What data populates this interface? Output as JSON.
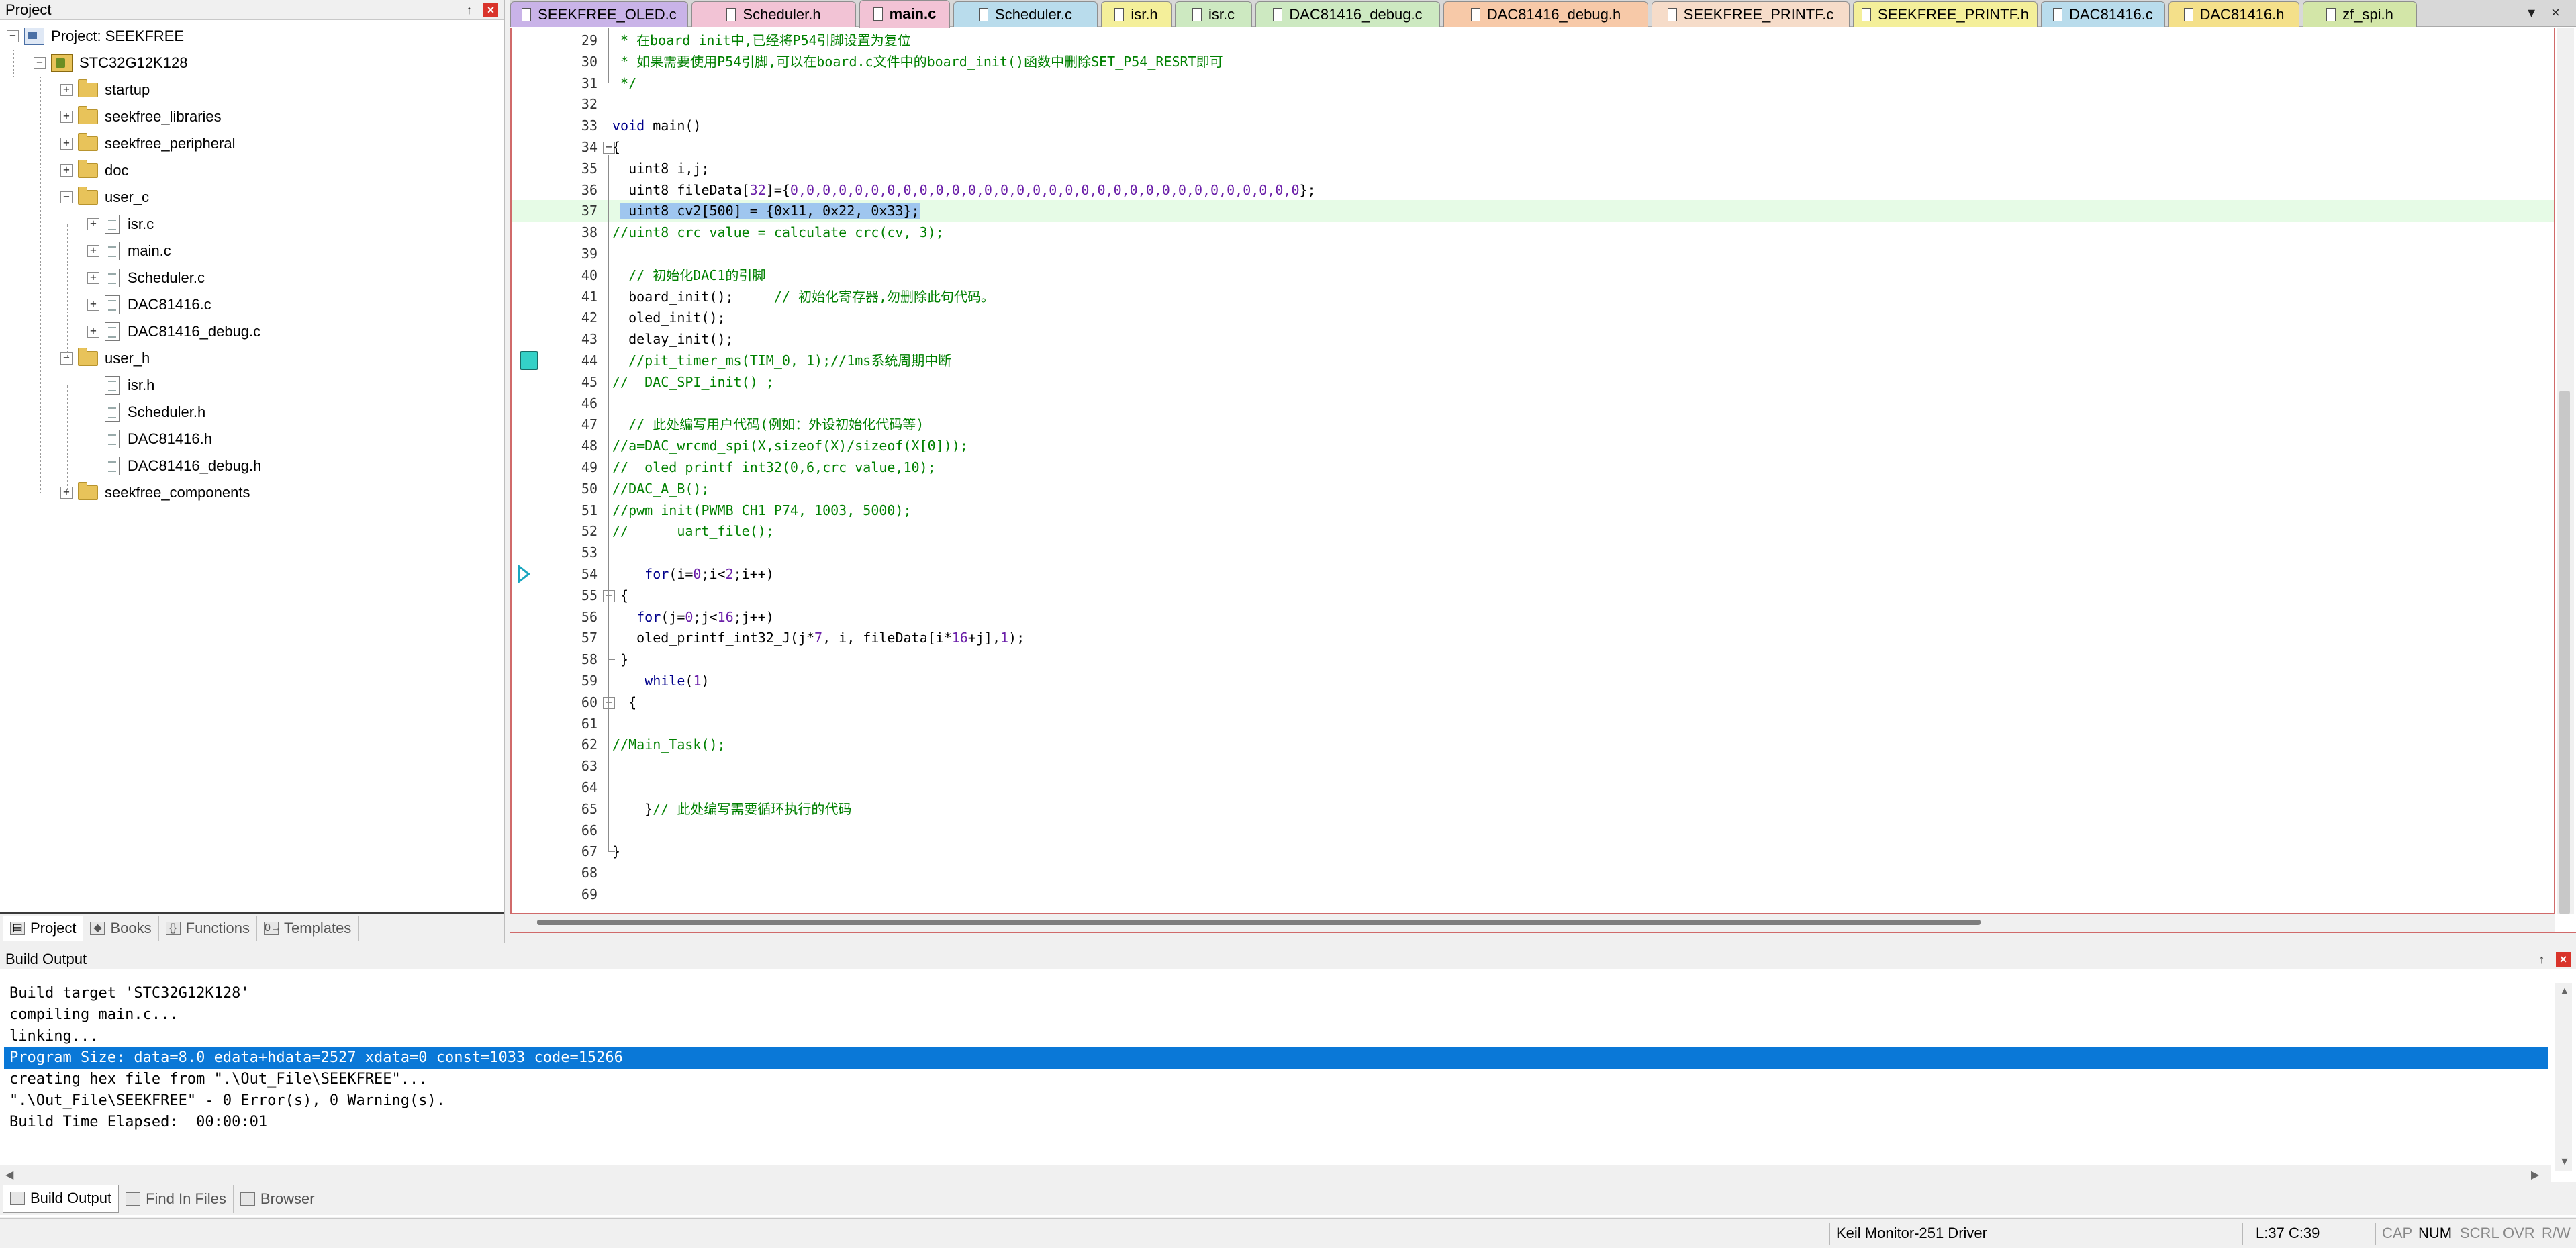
{
  "project_pane": {
    "title": "Project",
    "pin": "↑",
    "close": "×",
    "tree": [
      {
        "label": "Project: SEEKFREE",
        "kind": "project",
        "depth": 0,
        "expander": "−"
      },
      {
        "label": "STC32G12K128",
        "kind": "target",
        "depth": 1,
        "expander": "−"
      },
      {
        "label": "startup",
        "kind": "folder",
        "depth": 2,
        "expander": "+"
      },
      {
        "label": "seekfree_libraries",
        "kind": "folder",
        "depth": 2,
        "expander": "+"
      },
      {
        "label": "seekfree_peripheral",
        "kind": "folder",
        "depth": 2,
        "expander": "+"
      },
      {
        "label": "doc",
        "kind": "folder",
        "depth": 2,
        "expander": "+"
      },
      {
        "label": "user_c",
        "kind": "folder",
        "depth": 2,
        "expander": "−"
      },
      {
        "label": "isr.c",
        "kind": "file",
        "depth": 3,
        "expander": "+"
      },
      {
        "label": "main.c",
        "kind": "file",
        "depth": 3,
        "expander": "+"
      },
      {
        "label": "Scheduler.c",
        "kind": "file",
        "depth": 3,
        "expander": "+"
      },
      {
        "label": "DAC81416.c",
        "kind": "file",
        "depth": 3,
        "expander": "+"
      },
      {
        "label": "DAC81416_debug.c",
        "kind": "file",
        "depth": 3,
        "expander": "+"
      },
      {
        "label": "user_h",
        "kind": "folder",
        "depth": 2,
        "expander": "−"
      },
      {
        "label": "isr.h",
        "kind": "file",
        "depth": 3,
        "expander": ""
      },
      {
        "label": "Scheduler.h",
        "kind": "file",
        "depth": 3,
        "expander": ""
      },
      {
        "label": "DAC81416.h",
        "kind": "file",
        "depth": 3,
        "expander": ""
      },
      {
        "label": "DAC81416_debug.h",
        "kind": "file",
        "depth": 3,
        "expander": ""
      },
      {
        "label": "seekfree_components",
        "kind": "folder",
        "depth": 2,
        "expander": "+"
      }
    ],
    "tabs": [
      {
        "label": "Project",
        "icon": "▤"
      },
      {
        "label": "Books",
        "icon": "◆"
      },
      {
        "label": "Functions",
        "icon": "{}"
      },
      {
        "label": "Templates",
        "icon": "0→"
      }
    ]
  },
  "file_tabs": [
    {
      "label": "SEEKFREE_OLED.c",
      "color": "#c9b3e8"
    },
    {
      "label": "Scheduler.h",
      "color": "#f2c3d5"
    },
    {
      "label": "main.c",
      "color": "#f2c3d5",
      "active": true
    },
    {
      "label": "Scheduler.c",
      "color": "#b9dcec"
    },
    {
      "label": "isr.h",
      "color": "#f4ef9a"
    },
    {
      "label": "isr.c",
      "color": "#cde9c1"
    },
    {
      "label": "DAC81416_debug.c",
      "color": "#cde9c1"
    },
    {
      "label": "DAC81416_debug.h",
      "color": "#f7c9a8"
    },
    {
      "label": "SEEKFREE_PRINTF.c",
      "color": "#f6dcc9"
    },
    {
      "label": "SEEKFREE_PRINTF.h",
      "color": "#f4ef9a"
    },
    {
      "label": "DAC81416.c",
      "color": "#b9dcec"
    },
    {
      "label": "DAC81416.h",
      "color": "#f4e08a"
    },
    {
      "label": "zf_spi.h",
      "color": "#d3e6a8"
    }
  ],
  "tab_controls": {
    "menu": "▾",
    "close": "×"
  },
  "code_lines": [
    {
      "n": "29",
      "parts": [
        {
          "t": " * 在board_init中,已经将P54引脚设置为复位",
          "c": "comment"
        }
      ]
    },
    {
      "n": "30",
      "parts": [
        {
          "t": " * 如果需要使用P54引脚,可以在board.c文件中的board_init()函数中删除SET_P54_RESRT即可",
          "c": "comment"
        }
      ]
    },
    {
      "n": "31",
      "parts": [
        {
          "t": " */",
          "c": "comment"
        }
      ]
    },
    {
      "n": "32",
      "parts": []
    },
    {
      "n": "33",
      "parts": [
        {
          "t": "void",
          "c": "kw"
        },
        {
          "t": " main()",
          "c": ""
        }
      ]
    },
    {
      "n": "34",
      "parts": [
        {
          "t": "{",
          "c": ""
        }
      ],
      "fold": "−"
    },
    {
      "n": "35",
      "parts": [
        {
          "t": "  uint8 i,j;",
          "c": ""
        }
      ]
    },
    {
      "n": "36",
      "parts": [
        {
          "t": "  uint8 fileData[",
          "c": ""
        },
        {
          "t": "32",
          "c": "num"
        },
        {
          "t": "]={",
          "c": ""
        },
        {
          "t": "0,0,0,0,0,0,0,0,0,0,0,0,0,0,0,0,0,0,0,0,0,0,0,0,0,0,0,0,0,0,0,0",
          "c": "num"
        },
        {
          "t": "};",
          "c": ""
        }
      ]
    },
    {
      "n": "37",
      "parts": [
        {
          "t": " ",
          "c": ""
        },
        {
          "t": " uint8 cv2[500] = {0x11, 0x22, 0x33};",
          "c": "sel"
        }
      ],
      "current": true
    },
    {
      "n": "38",
      "parts": [
        {
          "t": "//uint8 crc_value = calculate_crc(cv, 3);",
          "c": "comment"
        }
      ]
    },
    {
      "n": "39",
      "parts": []
    },
    {
      "n": "40",
      "parts": [
        {
          "t": "  // 初始化DAC1的引脚",
          "c": "comment"
        }
      ]
    },
    {
      "n": "41",
      "parts": [
        {
          "t": "  board_init();     ",
          "c": ""
        },
        {
          "t": "// 初始化寄存器,勿删除此句代码。",
          "c": "comment"
        }
      ]
    },
    {
      "n": "42",
      "parts": [
        {
          "t": "  oled_init();",
          "c": ""
        }
      ]
    },
    {
      "n": "43",
      "parts": [
        {
          "t": "  delay_init();",
          "c": ""
        }
      ]
    },
    {
      "n": "44",
      "parts": [
        {
          "t": "  //pit_timer_ms(TIM_0, 1);//1ms系统周期中断",
          "c": "comment"
        }
      ],
      "marker": "bookmark"
    },
    {
      "n": "45",
      "parts": [
        {
          "t": "//  DAC_SPI_init() ;",
          "c": "comment"
        }
      ]
    },
    {
      "n": "46",
      "parts": []
    },
    {
      "n": "47",
      "parts": [
        {
          "t": "  // 此处编写用户代码(例如：外设初始化代码等)",
          "c": "comment"
        }
      ]
    },
    {
      "n": "48",
      "parts": [
        {
          "t": "//a=DAC_wrcmd_spi(X,sizeof(X)/sizeof(X[0]));",
          "c": "comment"
        }
      ]
    },
    {
      "n": "49",
      "parts": [
        {
          "t": "//  oled_printf_int32(0,6,crc_value,10);",
          "c": "comment"
        }
      ]
    },
    {
      "n": "50",
      "parts": [
        {
          "t": "//DAC_A_B();",
          "c": "comment"
        }
      ]
    },
    {
      "n": "51",
      "parts": [
        {
          "t": "//pwm_init(PWMB_CH1_P74, 1003, 5000);",
          "c": "comment"
        }
      ]
    },
    {
      "n": "52",
      "parts": [
        {
          "t": "//      uart_file();",
          "c": "comment"
        }
      ]
    },
    {
      "n": "53",
      "parts": []
    },
    {
      "n": "54",
      "parts": [
        {
          "t": "    ",
          "c": ""
        },
        {
          "t": "for",
          "c": "kw"
        },
        {
          "t": "(i=",
          "c": ""
        },
        {
          "t": "0",
          "c": "num"
        },
        {
          "t": ";i<",
          "c": ""
        },
        {
          "t": "2",
          "c": "num"
        },
        {
          "t": ";i++)",
          "c": ""
        }
      ],
      "marker": "arrow"
    },
    {
      "n": "55",
      "parts": [
        {
          "t": " {",
          "c": ""
        }
      ],
      "fold": "−"
    },
    {
      "n": "56",
      "parts": [
        {
          "t": "   ",
          "c": ""
        },
        {
          "t": "for",
          "c": "kw"
        },
        {
          "t": "(j=",
          "c": ""
        },
        {
          "t": "0",
          "c": "num"
        },
        {
          "t": ";j<",
          "c": ""
        },
        {
          "t": "16",
          "c": "num"
        },
        {
          "t": ";j++)",
          "c": ""
        }
      ]
    },
    {
      "n": "57",
      "parts": [
        {
          "t": "   oled_printf_int32_J(j*",
          "c": ""
        },
        {
          "t": "7",
          "c": "num"
        },
        {
          "t": ", i, fileData[i*",
          "c": ""
        },
        {
          "t": "16",
          "c": "num"
        },
        {
          "t": "+j],",
          "c": ""
        },
        {
          "t": "1",
          "c": "num"
        },
        {
          "t": ");",
          "c": ""
        }
      ]
    },
    {
      "n": "58",
      "parts": [
        {
          "t": " }",
          "c": ""
        }
      ]
    },
    {
      "n": "59",
      "parts": [
        {
          "t": "    ",
          "c": ""
        },
        {
          "t": "while",
          "c": "kw"
        },
        {
          "t": "(",
          "c": ""
        },
        {
          "t": "1",
          "c": "num"
        },
        {
          "t": ")",
          "c": ""
        }
      ]
    },
    {
      "n": "60",
      "parts": [
        {
          "t": "  {",
          "c": ""
        }
      ],
      "fold": "−"
    },
    {
      "n": "61",
      "parts": []
    },
    {
      "n": "62",
      "parts": [
        {
          "t": "//Main_Task();",
          "c": "comment"
        }
      ]
    },
    {
      "n": "63",
      "parts": []
    },
    {
      "n": "64",
      "parts": []
    },
    {
      "n": "65",
      "parts": [
        {
          "t": "    }",
          "c": ""
        },
        {
          "t": "// 此处编写需要循环执行的代码",
          "c": "comment"
        }
      ]
    },
    {
      "n": "66",
      "parts": []
    },
    {
      "n": "67",
      "parts": [
        {
          "t": "}",
          "c": ""
        }
      ]
    },
    {
      "n": "68",
      "parts": []
    },
    {
      "n": "69",
      "parts": []
    }
  ],
  "build_output": {
    "title": "Build Output",
    "pin": "↑",
    "close": "×",
    "lines": [
      "Build target 'STC32G12K128'",
      "compiling main.c...",
      "linking...",
      "Program Size: data=8.0 edata+hdata=2527 xdata=0 const=1033 code=15266",
      "creating hex file from \".\\Out_File\\SEEKFREE\"...",
      "\".\\Out_File\\SEEKFREE\" - 0 Error(s), 0 Warning(s).",
      "Build Time Elapsed:  00:00:01"
    ],
    "highlighted_line": 3,
    "tabs": [
      {
        "label": "Build Output",
        "active": true
      },
      {
        "label": "Find In Files"
      },
      {
        "label": "Browser"
      }
    ]
  },
  "status_bar": {
    "driver": "Keil Monitor-251 Driver",
    "position": "L:37 C:39",
    "caps": "CAP",
    "num": "NUM",
    "scroll": "SCRL",
    "ovr": "OVR",
    "rw": "R/W"
  },
  "colors": {
    "selection": "#0a78d7",
    "comment": "#008000",
    "keyword": "#00008b",
    "number": "#6a1ea8",
    "current_line": "#e6fbe6",
    "editor_border": "#d06a6a"
  }
}
